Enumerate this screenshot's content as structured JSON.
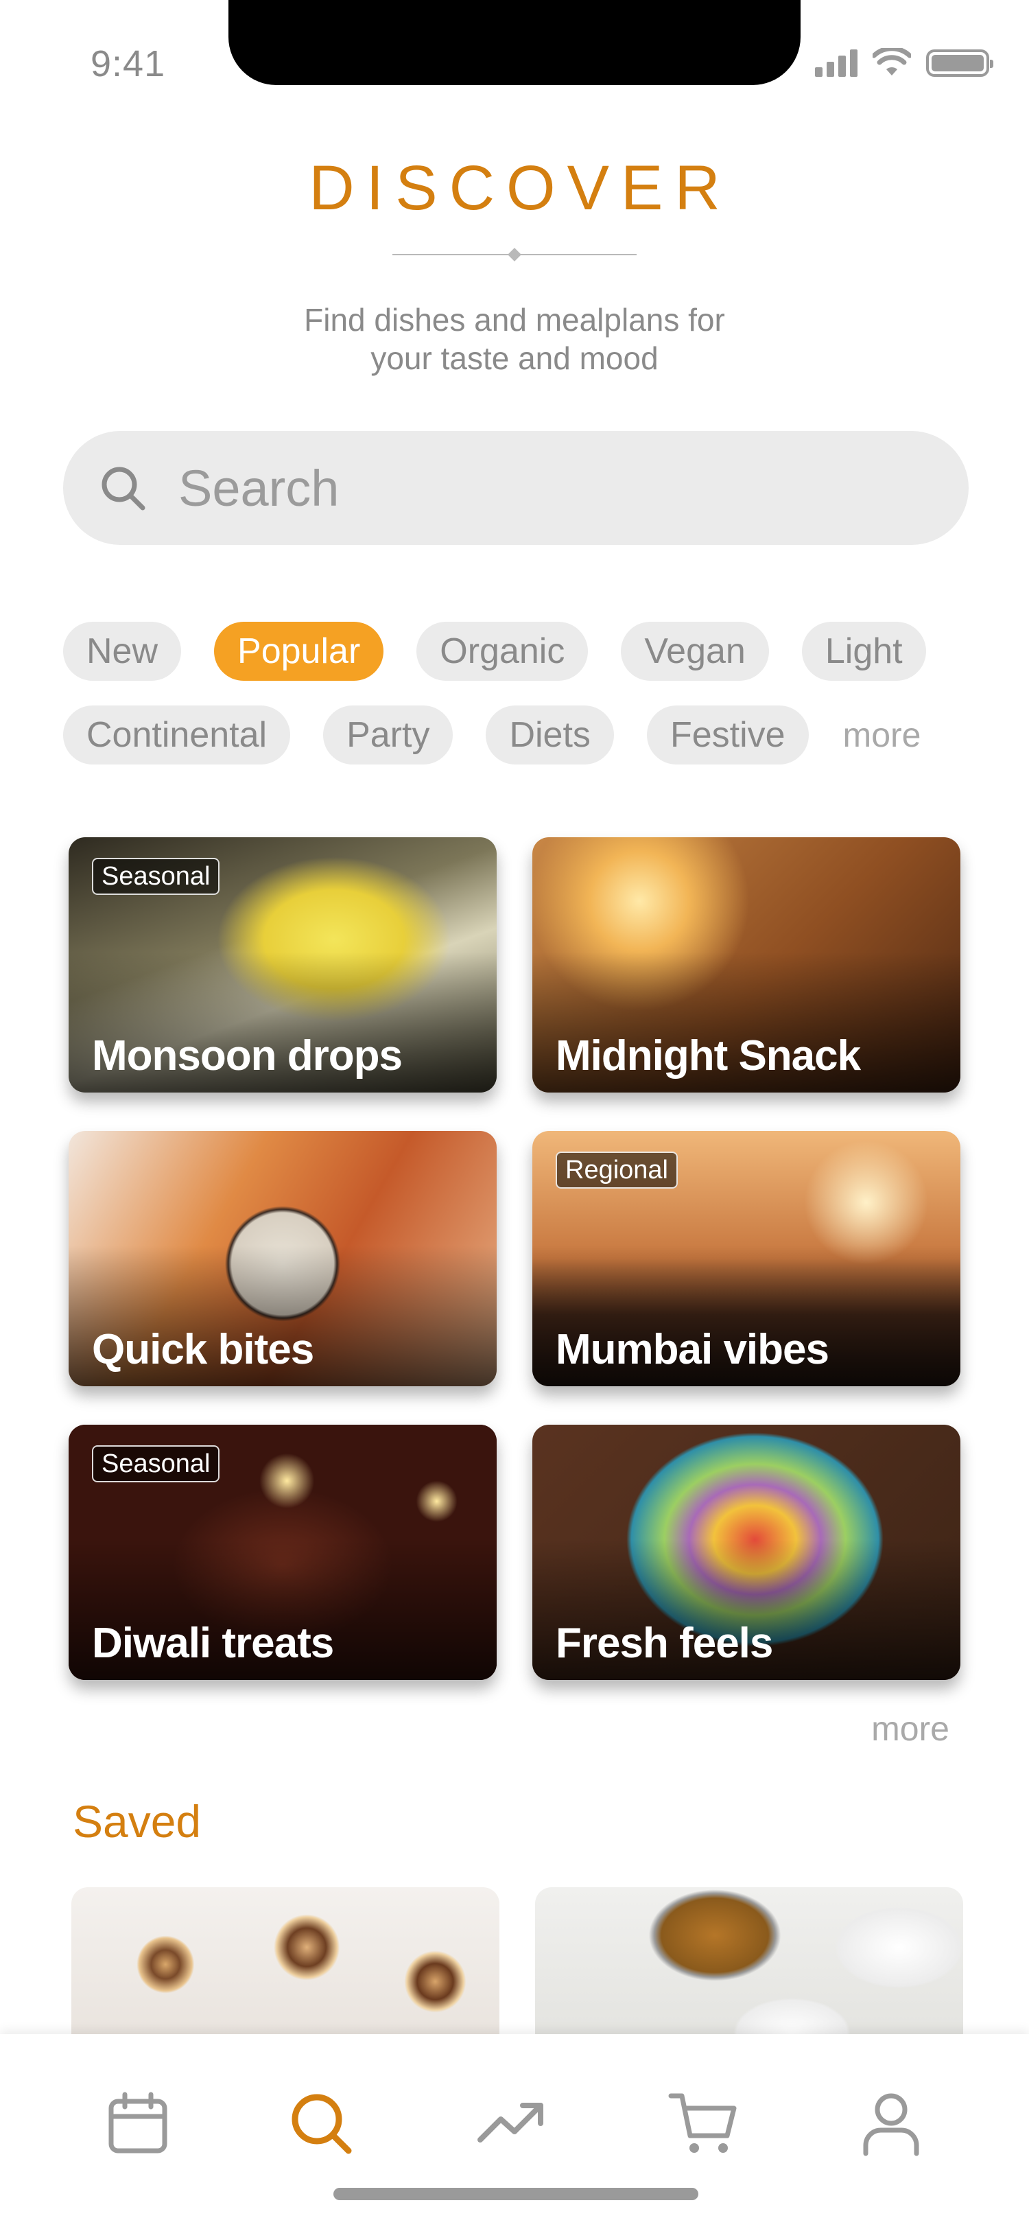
{
  "status_bar": {
    "time": "9:41"
  },
  "header": {
    "title": "DISCOVER",
    "subtitle_line1": "Find dishes and mealplans for",
    "subtitle_line2": "your taste and mood"
  },
  "search": {
    "placeholder": "Search",
    "value": ""
  },
  "filters": {
    "row1": [
      "New",
      "Popular",
      "Organic",
      "Vegan",
      "Light"
    ],
    "row2": [
      "Continental",
      "Party",
      "Diets",
      "Festive"
    ],
    "selected": "Popular",
    "more_label": "more"
  },
  "categories": [
    {
      "label": "Monsoon drops",
      "tag": "Seasonal"
    },
    {
      "label": "Midnight Snack",
      "tag": ""
    },
    {
      "label": "Quick bites",
      "tag": ""
    },
    {
      "label": "Mumbai vibes",
      "tag": "Regional"
    },
    {
      "label": "Diwali treats",
      "tag": "Seasonal"
    },
    {
      "label": "Fresh feels",
      "tag": ""
    }
  ],
  "categories_more_label": "more",
  "saved": {
    "title": "Saved"
  },
  "tabbar": {
    "items": [
      {
        "icon": "calendar-icon",
        "active": false
      },
      {
        "icon": "search-icon",
        "active": true
      },
      {
        "icon": "trending-icon",
        "active": false
      },
      {
        "icon": "cart-icon",
        "active": false
      },
      {
        "icon": "profile-icon",
        "active": false
      }
    ]
  },
  "colors": {
    "accent": "#d47f10",
    "chip_active": "#f5a123",
    "chip_bg": "#ebebeb",
    "muted_text": "#8a8a8a"
  }
}
